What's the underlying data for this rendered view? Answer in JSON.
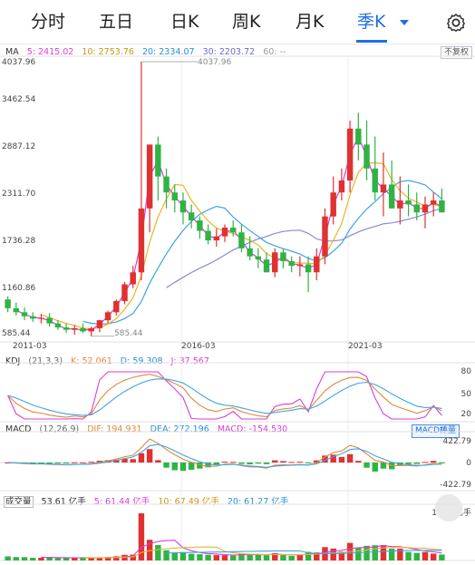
{
  "tabs": [
    {
      "label": "分时"
    },
    {
      "label": "五日"
    },
    {
      "label": "日K"
    },
    {
      "label": "周K"
    },
    {
      "label": "月K"
    },
    {
      "label": "季K",
      "active": true
    }
  ],
  "ma": {
    "label": "MA",
    "ma5": "5: 2415.02",
    "ma10": "10: 2753.76",
    "ma20": "20: 2334.07",
    "ma30": "30: 2203.72",
    "ma60": "60: --",
    "adjust": "不复权"
  },
  "price_axis": [
    "4037.96",
    "3462.54",
    "2887.12",
    "2311.70",
    "1736.28",
    "1160.86",
    "585.44"
  ],
  "high_marker": "4037.96",
  "low_marker": "585.44",
  "date_axis": [
    "2011-03",
    "2016-03",
    "2021-03"
  ],
  "kdj": {
    "name": "KDJ",
    "params": "(21,3,3)",
    "k": "K: 52.061",
    "d": "D: 59.308",
    "j": "J: 37.567",
    "axis": [
      "80",
      "50",
      "20"
    ]
  },
  "macd": {
    "name": "MACD",
    "params": "(12,26,9)",
    "dif": "DIF: 194.931",
    "dea": "DEA: 272.196",
    "macd": "MACD: -154.530",
    "button": "MACD棒量",
    "axis": [
      "422.79",
      "0",
      "-422.79"
    ]
  },
  "volume": {
    "name": "成交量",
    "value": "53.61 亿手",
    "ma5": "5: 61.44 亿手",
    "ma10": "10: 67.49 亿手",
    "ma20": "20: 61.27 亿手",
    "axis_top": "102.7亿手"
  },
  "colors": {
    "up": "#e03131",
    "down": "#2fb344",
    "ma5": "#d63fd6",
    "ma10": "#e8b62a",
    "ma20": "#3ea3e6",
    "ma30": "#8888dd",
    "accent": "#1e6fe0"
  },
  "chart_data": {
    "type": "candlestick",
    "x": [
      "2011Q1",
      "2011Q2",
      "2011Q3",
      "2011Q4",
      "2012Q1",
      "2012Q2",
      "2012Q3",
      "2012Q4",
      "2013Q1",
      "2013Q2",
      "2013Q3",
      "2013Q4",
      "2014Q1",
      "2014Q2",
      "2014Q3",
      "2014Q4",
      "2015Q1",
      "2015Q2",
      "2015Q3",
      "2015Q4",
      "2016Q1",
      "2016Q2",
      "2016Q3",
      "2016Q4",
      "2017Q1",
      "2017Q2",
      "2017Q3",
      "2017Q4",
      "2018Q1",
      "2018Q2",
      "2018Q3",
      "2018Q4",
      "2019Q1",
      "2019Q2",
      "2019Q3",
      "2019Q4",
      "2020Q1",
      "2020Q2",
      "2020Q3",
      "2020Q4",
      "2021Q1",
      "2021Q2",
      "2021Q3",
      "2021Q4",
      "2022Q1",
      "2022Q2",
      "2022Q3",
      "2022Q4",
      "2023Q1",
      "2023Q2",
      "2023Q3",
      "2023Q4",
      "2024Q1"
    ],
    "open": [
      1060,
      950,
      900,
      850,
      820,
      830,
      760,
      710,
      680,
      700,
      660,
      700,
      800,
      900,
      1040,
      1250,
      1400,
      2200,
      3000,
      2600,
      2400,
      2300,
      2150,
      2050,
      1920,
      1800,
      1850,
      1960,
      1900,
      1700,
      1600,
      1560,
      1400,
      1650,
      1540,
      1480,
      1500,
      1400,
      1600,
      2100,
      2400,
      2550,
      3200,
      3000,
      2700,
      2400,
      2500,
      2200,
      2300,
      2250,
      2150,
      2250,
      2300
    ],
    "high": [
      1100,
      1020,
      960,
      900,
      880,
      890,
      800,
      760,
      740,
      760,
      720,
      800,
      920,
      1060,
      1280,
      1480,
      4037.96,
      3000,
      3100,
      2700,
      2500,
      2400,
      2250,
      2100,
      2000,
      1950,
      2000,
      2050,
      2000,
      1850,
      1700,
      1650,
      1700,
      1700,
      1600,
      1600,
      1600,
      1700,
      2200,
      2600,
      2700,
      3300,
      3400,
      3300,
      3100,
      2900,
      2800,
      2600,
      2500,
      2400,
      2350,
      2400,
      2450
    ],
    "low": [
      900,
      860,
      800,
      780,
      760,
      720,
      680,
      640,
      620,
      640,
      600,
      650,
      760,
      860,
      1000,
      1200,
      1300,
      1900,
      2300,
      2200,
      2150,
      2000,
      1950,
      1820,
      1750,
      1720,
      1780,
      1850,
      1650,
      1550,
      1450,
      1400,
      1340,
      1450,
      1400,
      1350,
      1150,
      1300,
      1500,
      2000,
      2300,
      2400,
      2800,
      2550,
      2300,
      2100,
      2200,
      2000,
      2100,
      2050,
      1950,
      2100,
      2200
    ],
    "close": [
      950,
      900,
      850,
      820,
      830,
      760,
      710,
      680,
      700,
      660,
      700,
      800,
      900,
      1040,
      1250,
      1400,
      2200,
      3000,
      2600,
      2400,
      2300,
      2150,
      2050,
      1920,
      1800,
      1850,
      1960,
      1900,
      1700,
      1600,
      1560,
      1400,
      1650,
      1540,
      1480,
      1500,
      1400,
      1600,
      2100,
      2400,
      2550,
      3200,
      3000,
      2700,
      2400,
      2500,
      2200,
      2300,
      2250,
      2150,
      2250,
      2300,
      2150
    ],
    "ylim": [
      585.44,
      4037.96
    ],
    "kdj": {
      "k": 52.061,
      "d": 59.308,
      "j": 37.567,
      "ylim": [
        0,
        100
      ]
    },
    "macd_values": {
      "dif": 194.931,
      "dea": 272.196,
      "macd": -154.53,
      "ylim": [
        -422.79,
        422.79
      ]
    },
    "volume": {
      "unit": "亿手",
      "max": 102.7
    }
  }
}
